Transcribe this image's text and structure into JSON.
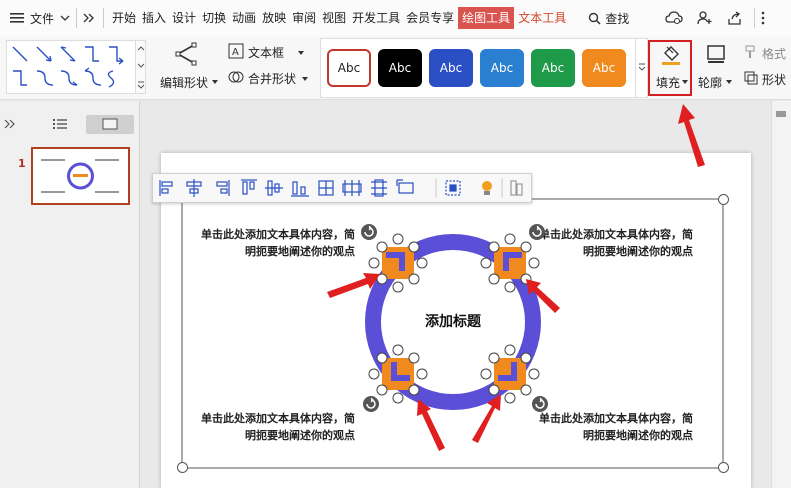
{
  "menu": {
    "file_label": "文件",
    "tabs": [
      {
        "label": "开始"
      },
      {
        "label": "插入"
      },
      {
        "label": "设计"
      },
      {
        "label": "切换"
      },
      {
        "label": "动画"
      },
      {
        "label": "放映"
      },
      {
        "label": "审阅"
      },
      {
        "label": "视图"
      },
      {
        "label": "开发工具"
      },
      {
        "label": "会员专享"
      },
      {
        "label": "绘图工具"
      },
      {
        "label": "文本工具"
      }
    ],
    "search_label": "查找"
  },
  "ribbon": {
    "edit_shape_label": "编辑形状",
    "text_box_label": "文本框",
    "merge_shape_label": "合并形状",
    "style_swatches": [
      {
        "label": "Abc",
        "bg": "#ffffff",
        "fg": "#222222",
        "border": "#c0392b"
      },
      {
        "label": "Abc",
        "bg": "#000000",
        "fg": "#ffffff",
        "border": "#000000"
      },
      {
        "label": "Abc",
        "bg": "#2a4fc4",
        "fg": "#ffffff",
        "border": "#2a4fc4"
      },
      {
        "label": "Abc",
        "bg": "#2b7fd1",
        "fg": "#ffffff",
        "border": "#2b7fd1"
      },
      {
        "label": "Abc",
        "bg": "#1e9a48",
        "fg": "#ffffff",
        "border": "#1e9a48"
      },
      {
        "label": "Abc",
        "bg": "#f08a1e",
        "fg": "#ffffff",
        "border": "#f08a1e"
      }
    ],
    "fill_label": "填充",
    "outline_label": "轮廓",
    "format_label": "格式",
    "shape_label": "形状"
  },
  "slides_panel": {
    "slide_number": "1"
  },
  "slide": {
    "title": "添加标题",
    "texts": [
      {
        "line1": "单击此处添加文本具体内容，简",
        "line2": "明扼要地阐述你的观点"
      },
      {
        "line1": "单击此处添加文本具体内容，简",
        "line2": "明扼要地阐述你的观点"
      },
      {
        "line1": "单击此处添加文本具体内容，简",
        "line2": "明扼要地阐述你的观点"
      },
      {
        "line1": "单击此处添加文本具体内容，简",
        "line2": "明扼要地阐述你的观点"
      }
    ]
  },
  "colors": {
    "accent_red": "#d9534f",
    "ring_purple": "#5a4fd6",
    "marker_orange": "#f08a1e",
    "arrow_red": "#e02020"
  }
}
